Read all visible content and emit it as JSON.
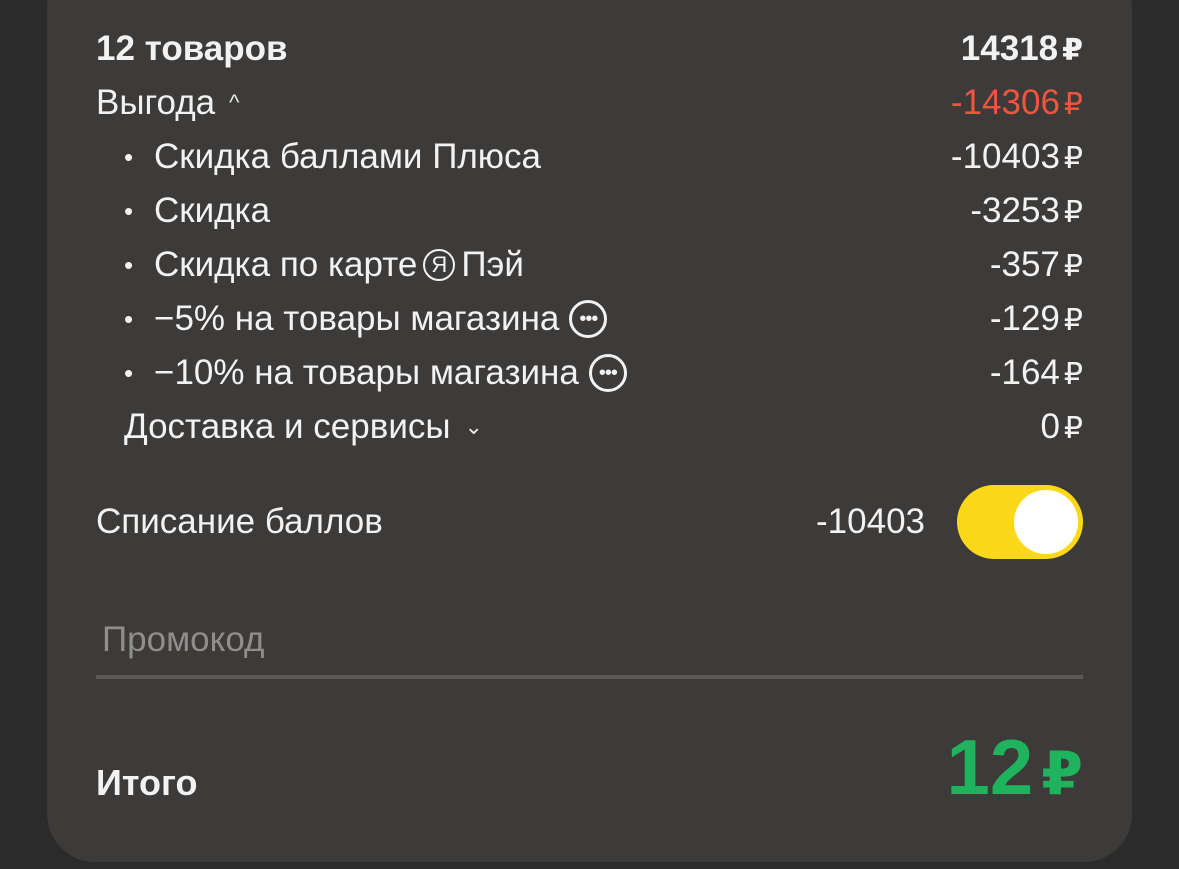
{
  "summary": {
    "label": "12 товаров",
    "amount": "14318",
    "currency": "₽"
  },
  "benefit": {
    "label": "Выгода",
    "chevron": "^",
    "amount": "-14306",
    "currency": "₽",
    "color": "#f0553d"
  },
  "discounts": [
    {
      "bullet": "•",
      "label": "Скидка баллами Плюса",
      "amount": "-10403",
      "currency": "₽"
    },
    {
      "bullet": "•",
      "label": "Скидка",
      "amount": "-3253",
      "currency": "₽"
    },
    {
      "bullet": "•",
      "label_before": "Скидка по карте",
      "logo": "Я",
      "label_after": "Пэй",
      "amount": "-357",
      "currency": "₽"
    },
    {
      "bullet": "•",
      "label": "−5% на товары магазина",
      "icon": "more-dots-icon",
      "amount": "-129",
      "currency": "₽"
    },
    {
      "bullet": "•",
      "label": "−10% на товары магазина",
      "icon": "more-dots-icon",
      "amount": "-164",
      "currency": "₽"
    }
  ],
  "delivery": {
    "label": "Доставка и сервисы",
    "chevron": "⌄",
    "amount": "0",
    "currency": "₽"
  },
  "points": {
    "label": "Списание баллов",
    "amount": "-10403",
    "toggle_on": true,
    "toggle_color": "#fbd91a"
  },
  "promo": {
    "placeholder": "Промокод"
  },
  "total": {
    "label": "Итого",
    "amount": "12",
    "currency": "₽",
    "color": "#1fb35d"
  }
}
